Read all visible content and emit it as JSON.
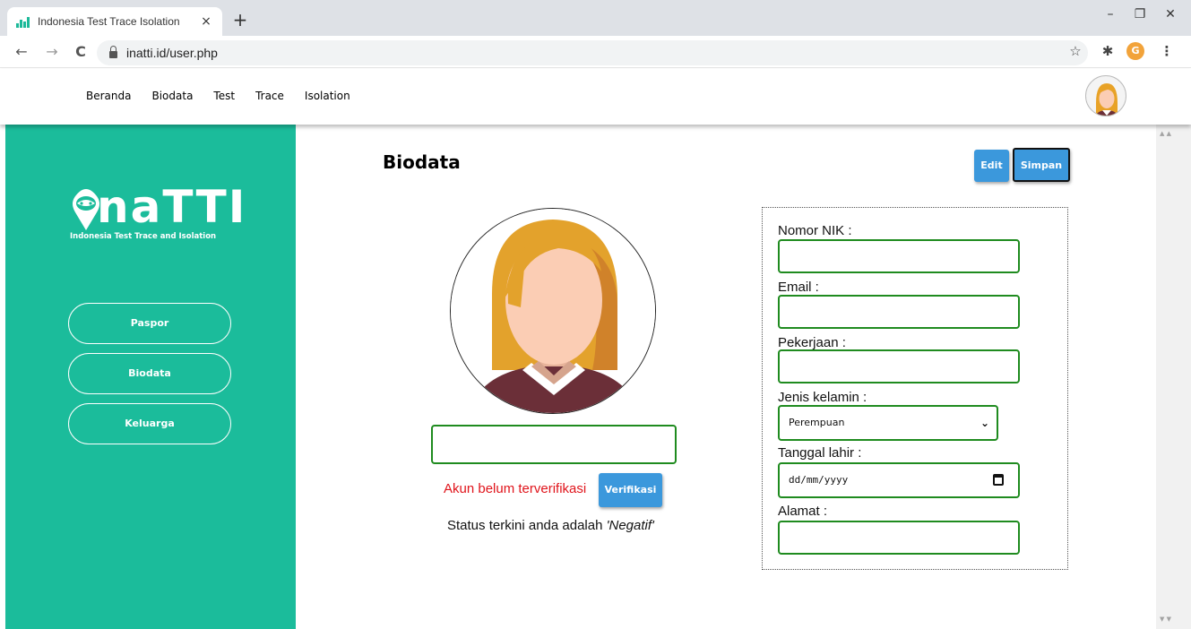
{
  "browser": {
    "tab_title": "Indonesia Test Trace Isolation",
    "tab_close": "×",
    "new_tab": "+",
    "url": "inatti.id/user.php",
    "back": "←",
    "forward": "→",
    "reload": "C",
    "bookmark": "☆",
    "extensions": "✱",
    "profile_initial": "G",
    "menu": "⋮",
    "minimize": "–",
    "restore": "❐",
    "close": "✕"
  },
  "nav": {
    "items": [
      "Beranda",
      "Biodata",
      "Test",
      "Trace",
      "Isolation"
    ]
  },
  "sidebar": {
    "logo_text": "naTTI",
    "logo_subtitle": "Indonesia Test Trace and Isolation",
    "buttons": [
      "Paspor",
      "Biodata",
      "Keluarga"
    ],
    "color": "#1bbc9b"
  },
  "main": {
    "title": "Biodata",
    "edit_label": "Edit",
    "save_label": "Simpan",
    "name_value": "",
    "verification_status": "Akun belum terverifikasi",
    "verify_label": "Verifikasi",
    "status_prefix": "Status terkini anda adalah ",
    "status_value": "'Negatif'"
  },
  "form": {
    "nik_label": "Nomor NIK :",
    "nik_value": "",
    "email_label": "Email :",
    "email_value": "",
    "job_label": "Pekerjaan :",
    "job_value": "",
    "gender_label": "Jenis kelamin :",
    "gender_value": "Perempuan",
    "dob_label": "Tanggal lahir :",
    "dob_placeholder": "dd/mm/yyyy",
    "address_label": "Alamat :",
    "address_value": ""
  },
  "colors": {
    "accent_green": "#1bbc9b",
    "button_blue": "#3b98dc",
    "input_border": "#1f8b1f",
    "error_red": "#e0141b"
  }
}
